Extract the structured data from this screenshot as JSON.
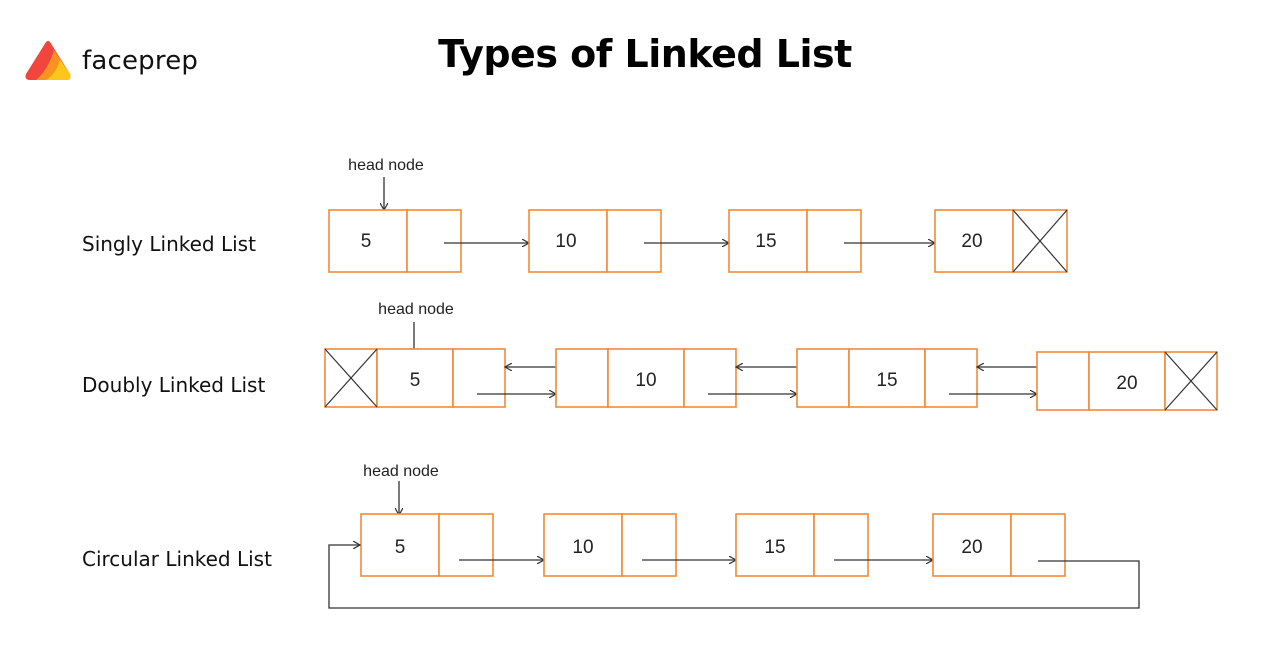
{
  "brand": {
    "name": "faceprep",
    "logo_colors": [
      "#f2453d",
      "#f7931e",
      "#ffc61a"
    ]
  },
  "title": "Types of Linked List",
  "colors": {
    "node_border": "#ee8a3a",
    "arrow": "#333333",
    "text": "#111111"
  },
  "head_label": "head node",
  "lists": [
    {
      "type": "singly",
      "label": "Singly Linked List",
      "values": [
        "5",
        "10",
        "15",
        "20"
      ],
      "null_terminated": true
    },
    {
      "type": "doubly",
      "label": "Doubly Linked List",
      "values": [
        "5",
        "10",
        "15",
        "20"
      ],
      "null_prev_head": true,
      "null_terminated": true
    },
    {
      "type": "circular",
      "label": "Circular Linked List",
      "values": [
        "5",
        "10",
        "15",
        "20"
      ],
      "loops_to_head": true
    }
  ]
}
